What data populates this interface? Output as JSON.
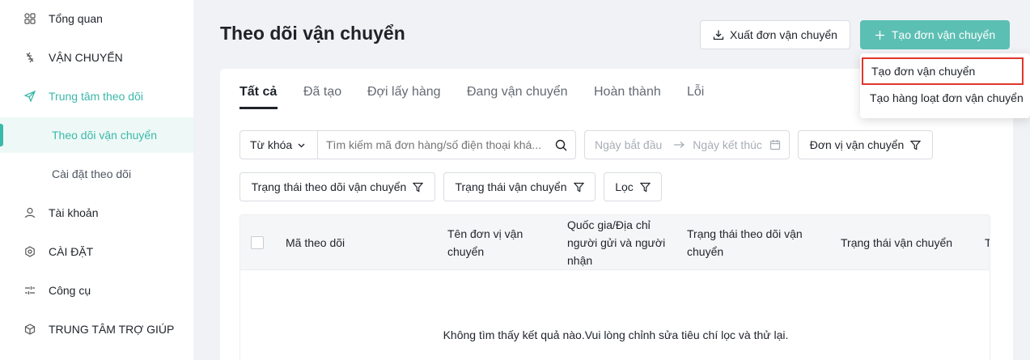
{
  "sidebar": {
    "items": [
      {
        "label": "Tổng quan",
        "icon": "overview-icon"
      },
      {
        "label": "VẬN CHUYỂN",
        "icon": "shipping-icon"
      },
      {
        "label": "Trung tâm theo dõi",
        "icon": "send-icon"
      },
      {
        "label": "Theo dõi vận chuyển"
      },
      {
        "label": "Cài đặt theo dõi"
      },
      {
        "label": "Tài khoản",
        "icon": "user-icon"
      },
      {
        "label": "CÀI ĐẶT",
        "icon": "settings-icon"
      },
      {
        "label": "Công cụ",
        "icon": "tools-icon"
      },
      {
        "label": "TRUNG TÂM TRỢ GIÚP",
        "icon": "help-center-icon"
      }
    ]
  },
  "header": {
    "title": "Theo dõi vận chuyển",
    "export_label": "Xuất đơn vận chuyển",
    "create_label": "Tạo đơn vận chuyển"
  },
  "dropdown": {
    "items": [
      "Tạo đơn vận chuyển",
      "Tạo hàng loạt đơn vận chuyển"
    ]
  },
  "tabs": [
    "Tất cả",
    "Đã tạo",
    "Đợi lấy hàng",
    "Đang vận chuyển",
    "Hoàn thành",
    "Lỗi"
  ],
  "filters": {
    "keyword_select": "Từ khóa",
    "search_placeholder": "Tìm kiếm mã đơn hàng/số điện thoại khá...",
    "start_date_placeholder": "Ngày bắt đầu",
    "end_date_placeholder": "Ngày kết thúc",
    "carrier": "Đơn vị vận chuyển",
    "tracking_status": "Trạng thái theo dõi vận chuyển",
    "shipping_status": "Trạng thái vận chuyển",
    "filter": "Lọc"
  },
  "table": {
    "columns": [
      "Mã theo dõi",
      "Tên đơn vị vận chuyển",
      "Quốc gia/Địa chỉ người gửi và người nhận",
      "Trạng thái theo dõi vận chuyển",
      "Trạng thái vận chuyển",
      "T"
    ],
    "empty_text": "Không tìm thấy kết quả nào.Vui lòng chỉnh sửa tiêu chí lọc và thử lại."
  },
  "colors": {
    "accent": "#3bb8a8",
    "primary_button": "#5cbfb3",
    "highlight_border": "#e0362c"
  }
}
